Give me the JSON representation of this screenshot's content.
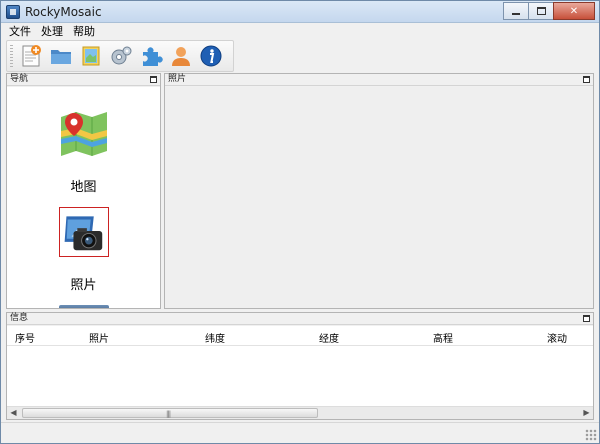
{
  "window": {
    "title": "RockyMosaic"
  },
  "menu": {
    "items": [
      "文件",
      "处理",
      "帮助"
    ]
  },
  "toolbar": {
    "buttons": [
      {
        "name": "new-document-icon"
      },
      {
        "name": "open-folder-icon"
      },
      {
        "name": "map-notes-icon"
      },
      {
        "name": "settings-gear-icon"
      },
      {
        "name": "plugin-puzzle-icon"
      },
      {
        "name": "user-icon"
      },
      {
        "name": "info-icon"
      }
    ]
  },
  "nav_panel": {
    "title": "导航",
    "items": [
      {
        "label": "地图",
        "icon": "map-pin-icon"
      },
      {
        "label": "照片",
        "icon": "camera-photo-icon",
        "selected": true
      }
    ]
  },
  "photos_panel": {
    "title": "照片"
  },
  "info_panel": {
    "title": "信息",
    "columns": [
      "序号",
      "照片",
      "纬度",
      "经度",
      "高程",
      "滚动"
    ]
  },
  "colors": {
    "title_bar": "#c4d7ee",
    "accent_selection": "#cc2222",
    "close_button": "#c7503a"
  }
}
